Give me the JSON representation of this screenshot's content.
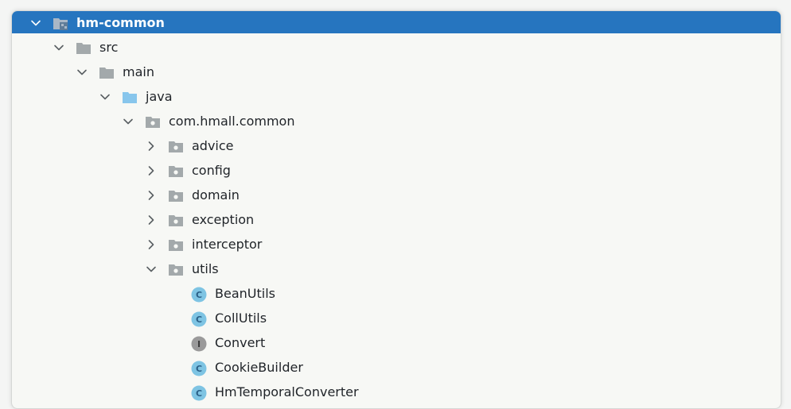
{
  "colors": {
    "selection": "#2675bf",
    "folder_gray": "#a3a9ab",
    "source_folder": "#88c6ec",
    "class_icon": "#7ec4e3",
    "interface_icon": "#9a9a9a"
  },
  "tree": [
    {
      "label": "hm-common",
      "state": "expanded",
      "icon": "module-icon",
      "selected": true
    },
    {
      "label": "src",
      "state": "expanded",
      "icon": "folder-icon"
    },
    {
      "label": "main",
      "state": "expanded",
      "icon": "folder-icon"
    },
    {
      "label": "java",
      "state": "expanded",
      "icon": "source-folder-icon"
    },
    {
      "label": "com.hmall.common",
      "state": "expanded",
      "icon": "package-icon"
    },
    {
      "label": "advice",
      "state": "collapsed",
      "icon": "package-icon"
    },
    {
      "label": "config",
      "state": "collapsed",
      "icon": "package-icon"
    },
    {
      "label": "domain",
      "state": "collapsed",
      "icon": "package-icon"
    },
    {
      "label": "exception",
      "state": "collapsed",
      "icon": "package-icon"
    },
    {
      "label": "interceptor",
      "state": "collapsed",
      "icon": "package-icon"
    },
    {
      "label": "utils",
      "state": "expanded",
      "icon": "package-icon"
    },
    {
      "label": "BeanUtils",
      "state": "leaf",
      "icon": "class-icon",
      "glyph": "C"
    },
    {
      "label": "CollUtils",
      "state": "leaf",
      "icon": "class-icon",
      "glyph": "C"
    },
    {
      "label": "Convert",
      "state": "leaf",
      "icon": "interface-icon",
      "glyph": "I"
    },
    {
      "label": "CookieBuilder",
      "state": "leaf",
      "icon": "class-icon",
      "glyph": "C"
    },
    {
      "label": "HmTemporalConverter",
      "state": "leaf",
      "icon": "class-icon",
      "glyph": "C"
    }
  ]
}
